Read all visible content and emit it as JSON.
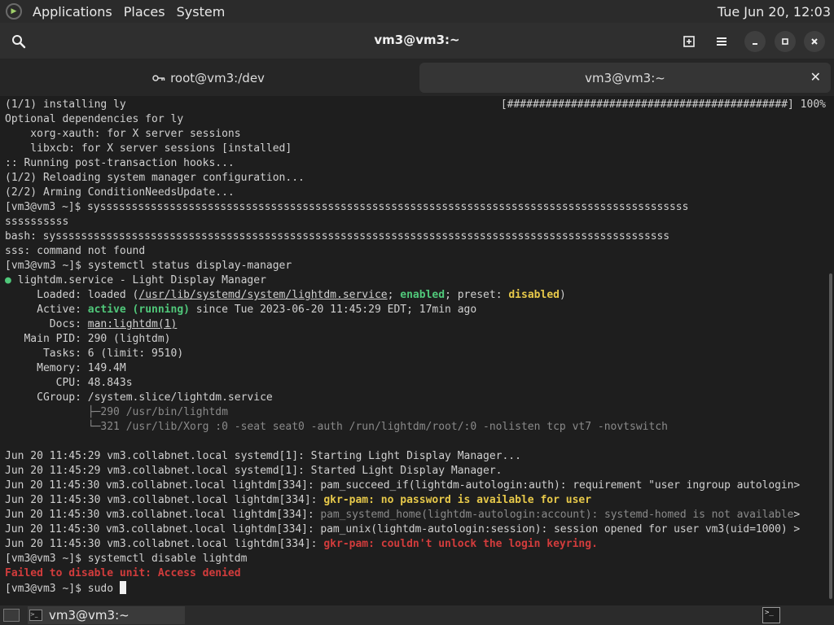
{
  "top_panel": {
    "menus": [
      "Applications",
      "Places",
      "System"
    ],
    "clock": "Tue Jun 20, 12:03"
  },
  "window": {
    "title": "vm3@vm3:~",
    "tabs": [
      {
        "label": "root@vm3:/dev",
        "icon": "key-icon",
        "active": false
      },
      {
        "label": "vm3@vm3:~",
        "active": true
      }
    ]
  },
  "terminal": {
    "progress_bar": "[############################################] 100%",
    "lines": [
      "(1/1) installing ly",
      "Optional dependencies for ly",
      "    xorg-xauth: for X server sessions",
      "    libxcb: for X server sessions [installed]",
      ":: Running post-transaction hooks...",
      "(1/2) Reloading system manager configuration...",
      "(2/2) Arming ConditionNeedsUpdate...",
      "[vm3@vm3 ~]$ sysssssssssssssssssssssssssssssssssssssssssssssssssssssssssssssssssssssssssssssssssssssssssssss",
      "ssssssssss",
      "bash: sysssssssssssssssssssssssssssssssssssssssssssssssssssssssssssssssssssssssssssssssssssssssssssssssss",
      "sss: command not found",
      "[vm3@vm3 ~]$ systemctl status display-manager",
      "lightdm.service - Light Display Manager",
      "     Loaded: loaded (",
      "/usr/lib/systemd/system/lightdm.service",
      "; ",
      "enabled",
      "; preset: ",
      "disabled",
      ")",
      "     Active: ",
      "active (running)",
      " since Tue 2023-06-20 11:45:29 EDT; 17min ago",
      "       Docs: ",
      "man:lightdm(1)",
      "   Main PID: 290 (lightdm)",
      "      Tasks: 6 (limit: 9510)",
      "     Memory: 149.4M",
      "        CPU: 48.843s",
      "     CGroup: /system.slice/lightdm.service",
      "             ├─290 /usr/bin/lightdm",
      "             └─321 /usr/lib/Xorg :0 -seat seat0 -auth /run/lightdm/root/:0 -nolisten tcp vt7 -novtswitch",
      "Jun 20 11:45:29 vm3.collabnet.local systemd[1]: Starting Light Display Manager...",
      "Jun 20 11:45:29 vm3.collabnet.local systemd[1]: Started Light Display Manager.",
      "Jun 20 11:45:30 vm3.collabnet.local lightdm[334]: pam_succeed_if(lightdm-autologin:auth): requirement \"user ingroup autologin>",
      "Jun 20 11:45:30 vm3.collabnet.local lightdm[334]: ",
      "gkr-pam: no password is available for user",
      "Jun 20 11:45:30 vm3.collabnet.local lightdm[334]: ",
      "pam_systemd_home(lightdm-autologin:account): systemd-homed is not available",
      ">",
      "Jun 20 11:45:30 vm3.collabnet.local lightdm[334]: pam_unix(lightdm-autologin:session): session opened for user vm3(uid=1000) >",
      "Jun 20 11:45:30 vm3.collabnet.local lightdm[334]: ",
      "gkr-pam: couldn't unlock the login keyring.",
      "[vm3@vm3 ~]$ systemctl disable lightdm",
      "Failed to disable unit: Access denied",
      "[vm3@vm3 ~]$ sudo "
    ]
  },
  "taskbar": {
    "task_label": "vm3@vm3:~"
  }
}
